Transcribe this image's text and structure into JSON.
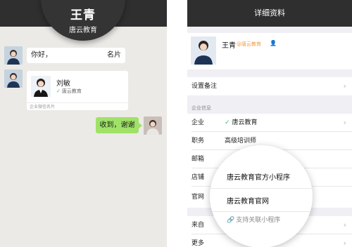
{
  "chat": {
    "header_name": "王青",
    "header_org": "唐云教育",
    "msg1_left": "你好，",
    "msg1_right": "名片",
    "card": {
      "name": "刘敏",
      "org": "唐云教育",
      "footer": "企业微信名片"
    },
    "reply": "收到，谢谢"
  },
  "detail": {
    "title": "详细资料",
    "profile": {
      "name": "王青",
      "org": "@唐云教育",
      "person_icon": "person-icon"
    },
    "remark_label": "设置备注",
    "section_title": "企业信息",
    "rows": [
      {
        "label": "企业",
        "value": "唐云教育"
      },
      {
        "label": "职务",
        "value": "高级培训师"
      },
      {
        "label": "邮箱",
        "value": ""
      },
      {
        "label": "店铺",
        "value": ""
      },
      {
        "label": "官网",
        "value": ""
      },
      {
        "label": "来自",
        "value": ""
      },
      {
        "label": "更多",
        "value": ""
      }
    ],
    "arrow": "›"
  },
  "magnifier": {
    "item1": "唐云教育官方小程序",
    "item2": "唐云教育官网",
    "link": "支持关联小程序"
  },
  "colors": {
    "header_dark": "#2f2f30",
    "green_bubble": "#9fe267",
    "verified_green": "#3db47a",
    "org_orange": "#f09a3e"
  }
}
